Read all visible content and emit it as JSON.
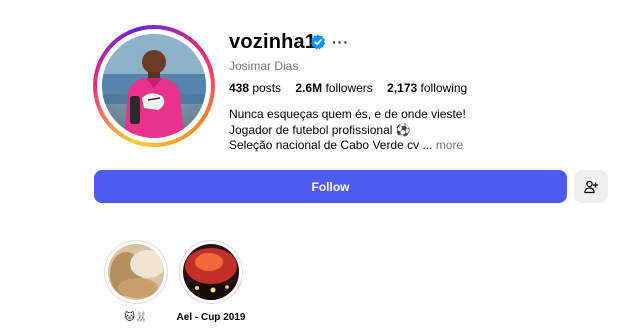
{
  "profile": {
    "username": "vozinha1",
    "full_name": "Josimar Dias",
    "more_label": "···",
    "stats": {
      "posts_count": "438",
      "posts_label": "posts",
      "followers_count": "2.6M",
      "followers_label": "followers",
      "following_count": "2,173",
      "following_label": "following"
    },
    "bio": {
      "line1": "Nunca esqueças quem és, e de onde vieste!",
      "line2": "Jogador de futebol profissional ⚽",
      "line3": "Seleção nacional de Cabo Verde cv ...",
      "more_link": "more"
    }
  },
  "actions": {
    "follow_label": "Follow",
    "add_user_icon": "add-person-icon"
  },
  "highlights": [
    {
      "label": "🐱🐰",
      "icon": "highlight-thumbnail"
    },
    {
      "label": "Ael - Cup 2019",
      "icon": "highlight-thumbnail"
    }
  ],
  "colors": {
    "follow_button": "#4f5cf2",
    "verified_badge": "#0095f6",
    "secondary_text": "#737373",
    "jersey": "#e8338a"
  }
}
